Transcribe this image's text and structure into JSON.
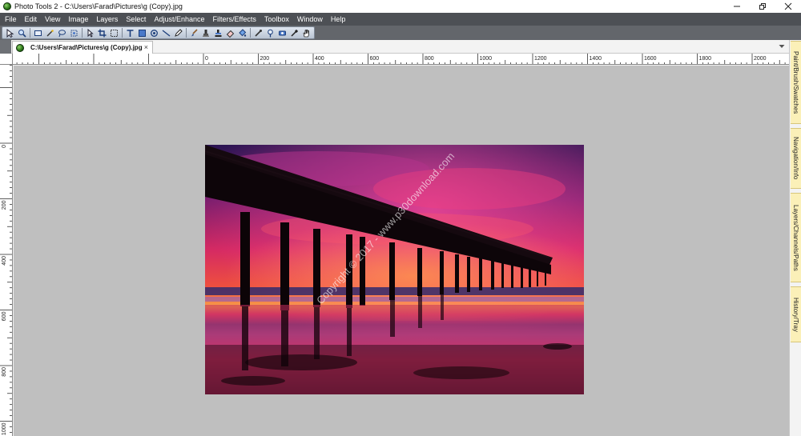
{
  "window": {
    "title": "Photo Tools 2 - C:\\Users\\Farad\\Pictures\\g (Copy).jpg"
  },
  "menu": [
    "File",
    "Edit",
    "View",
    "Image",
    "Layers",
    "Select",
    "Adjust/Enhance",
    "Filters/Effects",
    "Toolbox",
    "Window",
    "Help"
  ],
  "toolbar_icons": [
    "pointer-icon",
    "zoom-icon",
    "rect-select-icon",
    "magic-wand-icon",
    "lasso-icon",
    "transform-icon",
    "move-icon",
    "crop-icon",
    "marquee-icon",
    "text-icon",
    "shape-icon",
    "warp-icon",
    "line-icon",
    "pen-icon",
    "brush-icon",
    "clone-icon",
    "stamp-icon",
    "eraser-icon",
    "fill-icon",
    "smudge-icon",
    "dodge-icon",
    "retouch-icon",
    "eyedropper-icon",
    "hand-icon"
  ],
  "document_tab": {
    "label": "C:\\Users\\Farad\\Pictures\\g (Copy).jpg",
    "close": "×"
  },
  "ruler_top_labels": [
    "0",
    "200",
    "400",
    "600",
    "800",
    "1000",
    "1200",
    "1400",
    "1600",
    "1800",
    "2000"
  ],
  "ruler_left_labels": [
    "0",
    "200",
    "400",
    "600",
    "800",
    "1000"
  ],
  "watermark": "Copyright © 2017 - www.p30download.com",
  "dock_tabs": [
    "Paint/Brush/Swatches",
    "Navigation/Info",
    "Layers/Channels/Paths",
    "History/Tray"
  ],
  "colors": {
    "menubar": "#4d5055",
    "toolbar": "#63666b",
    "canvas": "#bfbfbf",
    "dock_tab": "#fbf0b8"
  }
}
